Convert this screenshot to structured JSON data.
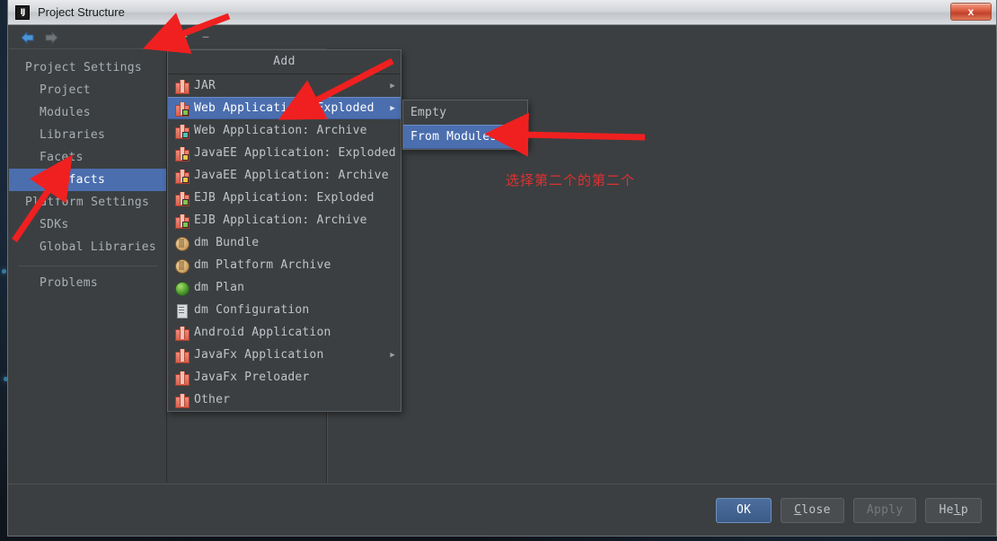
{
  "window": {
    "title": "Project Structure",
    "logo_text": "IJ",
    "close_label": "x"
  },
  "nav": {
    "back_icon": "back-arrow-icon",
    "forward_icon": "forward-arrow-icon"
  },
  "sidebar": {
    "groups": [
      {
        "label": "Project Settings",
        "items": [
          {
            "label": "Project",
            "selected": false
          },
          {
            "label": "Modules",
            "selected": false
          },
          {
            "label": "Libraries",
            "selected": false
          },
          {
            "label": "Facets",
            "selected": false
          },
          {
            "label": "Artifacts",
            "selected": true
          }
        ]
      },
      {
        "label": "Platform Settings",
        "items": [
          {
            "label": "SDKs",
            "selected": false
          },
          {
            "label": "Global Libraries",
            "selected": false
          }
        ]
      }
    ],
    "problems_label": "Problems"
  },
  "toolbar": {
    "add_label": "+",
    "remove_label": "–",
    "add_icon": "plus-icon",
    "remove_icon": "minus-icon"
  },
  "add_menu": {
    "title": "Add",
    "items": [
      {
        "label": "JAR",
        "icon": "artifact-jar-icon",
        "badge": "",
        "submenu": true,
        "selected": false
      },
      {
        "label": "Web Application: Exploded",
        "icon": "artifact-web-exploded-icon",
        "badge": "green",
        "submenu": true,
        "selected": true
      },
      {
        "label": "Web Application: Archive",
        "icon": "artifact-web-archive-icon",
        "badge": "teal",
        "submenu": false,
        "selected": false
      },
      {
        "label": "JavaEE Application: Exploded",
        "icon": "artifact-javaee-exploded-icon",
        "badge": "yellow",
        "submenu": false,
        "selected": false
      },
      {
        "label": "JavaEE Application: Archive",
        "icon": "artifact-javaee-archive-icon",
        "badge": "yellow",
        "submenu": false,
        "selected": false
      },
      {
        "label": "EJB Application: Exploded",
        "icon": "artifact-ejb-exploded-icon",
        "badge": "green",
        "submenu": false,
        "selected": false
      },
      {
        "label": "EJB Application: Archive",
        "icon": "artifact-ejb-archive-icon",
        "badge": "green",
        "submenu": false,
        "selected": false
      },
      {
        "label": "dm Bundle",
        "icon": "dm-bundle-icon",
        "badge": "",
        "submenu": false,
        "selected": false
      },
      {
        "label": "dm Platform Archive",
        "icon": "dm-platform-archive-icon",
        "badge": "",
        "submenu": false,
        "selected": false
      },
      {
        "label": "dm Plan",
        "icon": "dm-plan-icon",
        "badge": "",
        "submenu": false,
        "selected": false
      },
      {
        "label": "dm Configuration",
        "icon": "dm-configuration-icon",
        "badge": "",
        "submenu": false,
        "selected": false
      },
      {
        "label": "Android Application",
        "icon": "artifact-android-icon",
        "badge": "",
        "submenu": false,
        "selected": false
      },
      {
        "label": "JavaFx Application",
        "icon": "artifact-javafx-icon",
        "badge": "",
        "submenu": true,
        "selected": false
      },
      {
        "label": "JavaFx Preloader",
        "icon": "artifact-javafx-preloader-icon",
        "badge": "",
        "submenu": false,
        "selected": false
      },
      {
        "label": "Other",
        "icon": "artifact-other-icon",
        "badge": "",
        "submenu": false,
        "selected": false
      }
    ]
  },
  "sub_menu": {
    "items": [
      {
        "label": "Empty",
        "selected": false
      },
      {
        "label": "From Modules...",
        "selected": true
      }
    ]
  },
  "footer": {
    "buttons": [
      {
        "label": "OK",
        "style": "default",
        "mnemonic": ""
      },
      {
        "label": "Close",
        "style": "normal",
        "mnemonic": "C"
      },
      {
        "label": "Apply",
        "style": "disabled",
        "mnemonic": ""
      },
      {
        "label": "Help",
        "style": "normal",
        "mnemonic": "l"
      }
    ]
  },
  "annotations": {
    "chinese_note": "选择第二个的第二个",
    "color": "#e03030",
    "arrows": [
      {
        "name": "arrow-to-add-button",
        "points_to": "plus-icon"
      },
      {
        "name": "arrow-to-web-app-exploded",
        "points_to": "Web Application: Exploded"
      },
      {
        "name": "arrow-to-from-modules",
        "points_to": "From Modules..."
      },
      {
        "name": "arrow-to-artifacts",
        "points_to": "Artifacts"
      }
    ]
  },
  "colors": {
    "window_bg": "#3c3f41",
    "selection_blue": "#4b6eaf",
    "text": "#bfc4c8",
    "annotation_red": "#e03030",
    "plus_green": "#62c462"
  }
}
